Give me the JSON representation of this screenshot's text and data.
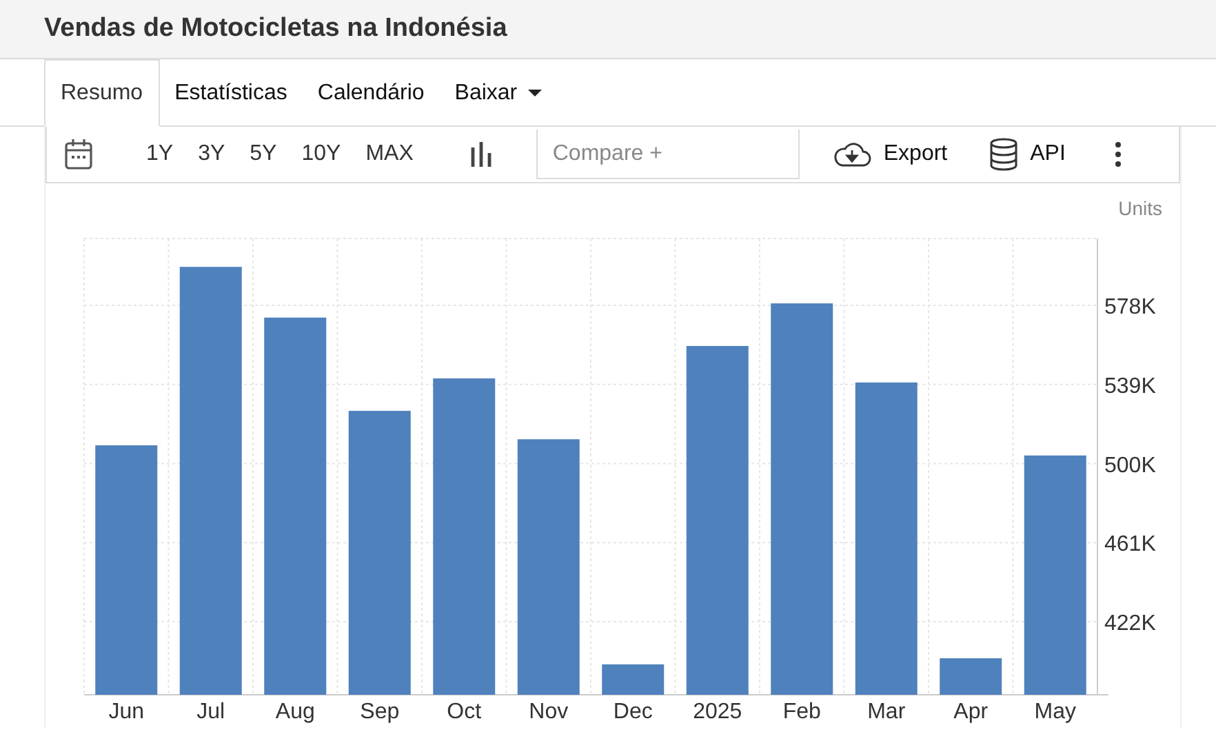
{
  "page_title": "Vendas de Motocicletas na Indonésia",
  "tabs": [
    {
      "label": "Resumo",
      "selected": true,
      "dropdown": false
    },
    {
      "label": "Estatísticas",
      "selected": false,
      "dropdown": false
    },
    {
      "label": "Calendário",
      "selected": false,
      "dropdown": false
    },
    {
      "label": "Baixar",
      "selected": false,
      "dropdown": true
    }
  ],
  "toolbar": {
    "ranges": [
      "1Y",
      "3Y",
      "5Y",
      "10Y",
      "MAX"
    ],
    "compare": {
      "placeholder": "Compare +"
    },
    "export": "Export",
    "api": "API"
  },
  "chart": {
    "chart_data": {
      "type": "bar",
      "grid": true,
      "categories": [
        "Jun",
        "Jul",
        "Aug",
        "Sep",
        "Oct",
        "Nov",
        "Dec",
        "2025",
        "Feb",
        "Mar",
        "Apr",
        "May"
      ],
      "series": [
        {
          "name": "Units",
          "color": "#4f81bd",
          "values": [
            509,
            597,
            572,
            526,
            542,
            512,
            401,
            558,
            579,
            540,
            404,
            504
          ]
        }
      ],
      "ylim": [
        386,
        611
      ],
      "yticks": [
        {
          "value": 422,
          "label": "422K"
        },
        {
          "value": 461,
          "label": "461K"
        },
        {
          "value": 500,
          "label": "500K"
        },
        {
          "value": 539,
          "label": "539K"
        },
        {
          "value": 578,
          "label": "578K"
        }
      ]
    }
  }
}
